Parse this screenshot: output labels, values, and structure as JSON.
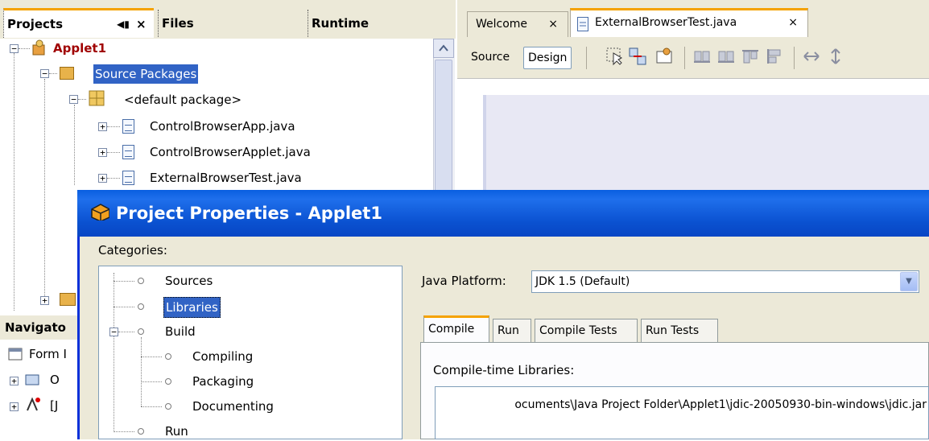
{
  "projects_panel": {
    "tabs": [
      {
        "label": "Projects",
        "active": true
      },
      {
        "label": "Files",
        "active": false
      },
      {
        "label": "Runtime",
        "active": false
      }
    ],
    "tab_controls": {
      "minimize": "◀▮",
      "close": "×"
    },
    "tree": [
      {
        "label": "Applet1",
        "type": "project",
        "expanded": true
      },
      {
        "label": "Source Packages",
        "type": "folder",
        "expanded": true,
        "selected": true
      },
      {
        "label": "<default package>",
        "type": "package",
        "expanded": true
      },
      {
        "label": "ControlBrowserApp.java",
        "type": "java-file"
      },
      {
        "label": "ControlBrowserApplet.java",
        "type": "java-file"
      },
      {
        "label": "ExternalBrowserTest.java",
        "type": "java-file"
      }
    ]
  },
  "navigator_panel": {
    "title": "Navigato",
    "items": [
      "Form I",
      "O",
      "[J"
    ]
  },
  "editor": {
    "tabs": [
      {
        "label": "Welcome",
        "close": "×",
        "active": false
      },
      {
        "label": "ExternalBrowserTest.java",
        "close": "×",
        "active": true
      }
    ],
    "toolbar": {
      "source_label": "Source",
      "design_label": "Design"
    }
  },
  "dialog": {
    "title": "Project Properties - Applet1",
    "categories_label": "Categories:",
    "categories": [
      {
        "label": "Sources",
        "level": 0
      },
      {
        "label": "Libraries",
        "level": 0,
        "selected": true
      },
      {
        "label": "Build",
        "level": 0,
        "expanded": true
      },
      {
        "label": "Compiling",
        "level": 1
      },
      {
        "label": "Packaging",
        "level": 1
      },
      {
        "label": "Documenting",
        "level": 1
      },
      {
        "label": "Run",
        "level": 0
      }
    ],
    "java_platform_label": "Java Platform:",
    "java_platform_value": "JDK 1.5 (Default)",
    "tabs": [
      {
        "label": "Compile",
        "active": true
      },
      {
        "label": "Run",
        "active": false
      },
      {
        "label": "Compile Tests",
        "active": false
      },
      {
        "label": "Run Tests",
        "active": false
      }
    ],
    "compile_libs_label": "Compile-time Libraries:",
    "compile_libs": [
      "ocuments\\Java Project Folder\\Applet1\\jdic-20050930-bin-windows\\jdic.jar"
    ]
  },
  "colors": {
    "selection": "#3163c5",
    "tab_accent": "#f5a200",
    "titlebar": "#0a51d0",
    "panel_bg": "#ece9d8"
  }
}
